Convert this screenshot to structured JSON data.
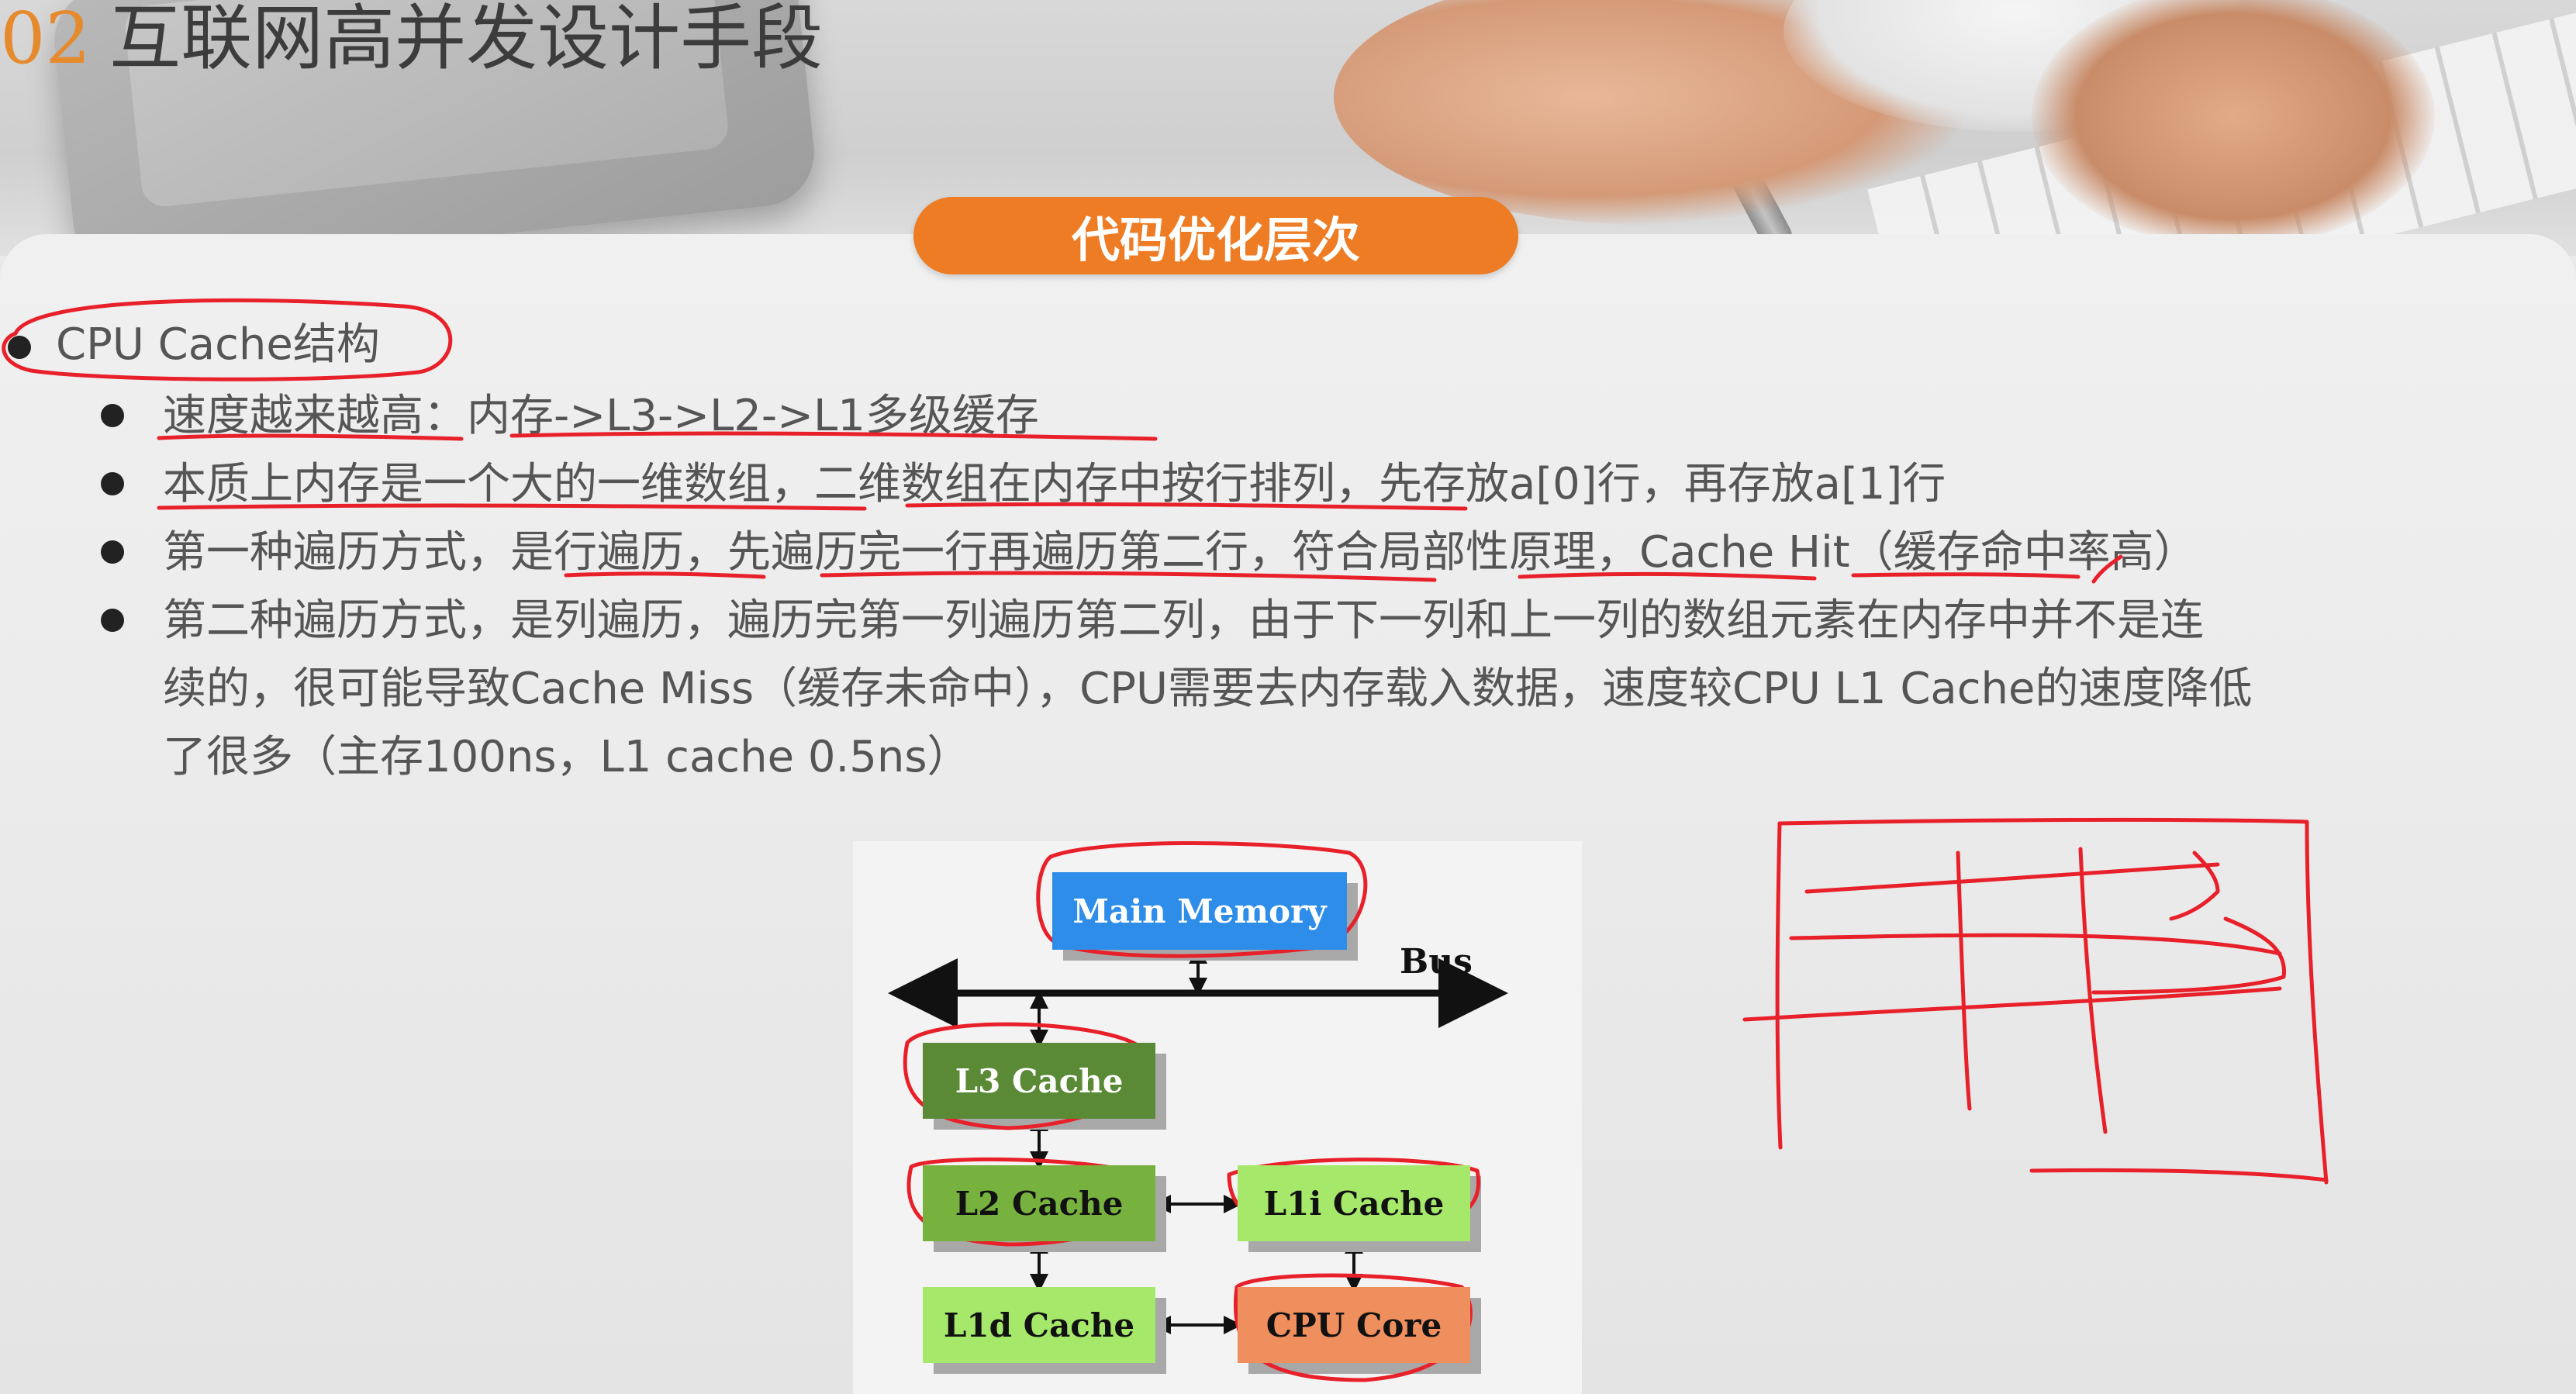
{
  "slide": {
    "number": "02",
    "title": "互联网高并发设计手段",
    "section_pill": "代码优化层次"
  },
  "content": {
    "main_bullet": "CPU Cache结构",
    "sub_bullets": [
      [
        "速度越来越高：内存->L3->L2->L1多级缓存"
      ],
      [
        "本质上内存是一个大的一维数组，二维数组在内存中按行排列，先存放a[0]行，再存放a[1]行"
      ],
      [
        "第一种遍历方式，是行遍历，先遍历完一行再遍历第二行，符合局部性原理，Cache Hit（缓存命中率高）"
      ],
      [
        "第二种遍历方式，是列遍历，遍历完第一列遍历第二列，由于下一列和上一列的数组元素在内存中并不是连",
        "续的，很可能导致Cache Miss（缓存未命中），CPU需要去内存载入数据，速度较CPU L1 Cache的速度降低",
        "了很多（主存100ns，L1 cache 0.5ns）"
      ]
    ]
  },
  "diagram": {
    "main_memory": "Main Memory",
    "bus": "Bus",
    "l3": "L3 Cache",
    "l2": "L2 Cache",
    "l1i": "L1i Cache",
    "l1d": "L1d Cache",
    "cpu_core": "CPU Core"
  },
  "colors": {
    "accent_orange": "#ee7c24",
    "title_number": "#e68a2e",
    "main_memory": "#2e8de8",
    "l3": "#5a8a36",
    "l2": "#78b23e",
    "l1": "#a6e86a",
    "cpu_core": "#ef8f5e",
    "annotation_red": "#e8202a"
  }
}
